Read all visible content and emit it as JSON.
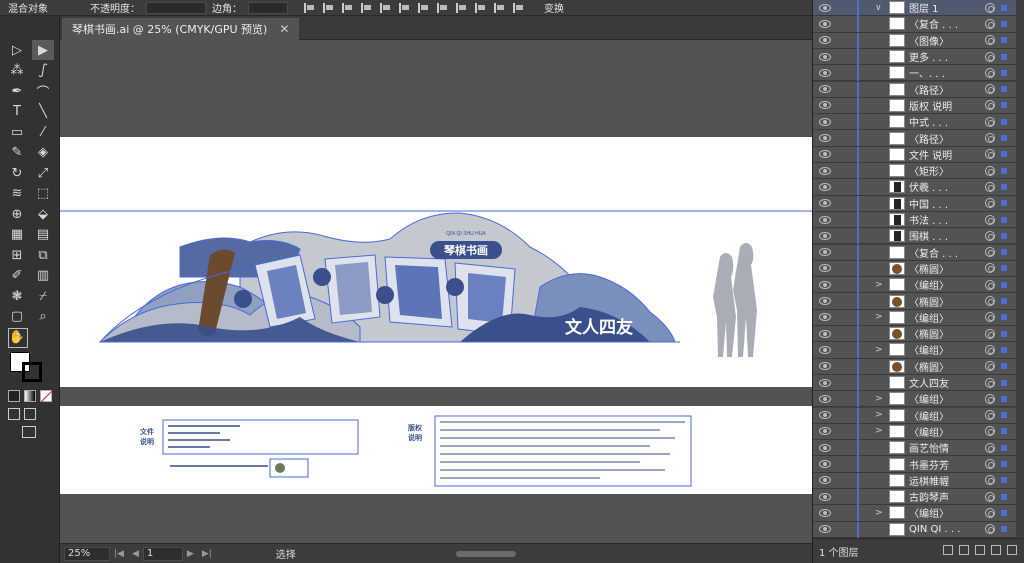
{
  "controlbar": {
    "blend_label": "混合对象",
    "opacity_label": "不透明度：",
    "corner_label": "边角：",
    "transform_label": "变换"
  },
  "document": {
    "tab_title": "琴棋书画.ai @ 25% (CMYK/GPU 预览)",
    "close_glyph": "✕"
  },
  "toolbar": {
    "help_label": "?",
    "left_tools": [
      "selection-tool",
      "magic-wand-tool",
      "pen-tool",
      "type-tool",
      "rectangle-tool",
      "pencil-tool",
      "rotate-tool",
      "warp-tool",
      "shape-builder-tool",
      "perspective-tool",
      "mesh-tool",
      "eyedropper-tool",
      "symbol-sprayer-tool",
      "artboard-tool",
      "hand-tool"
    ],
    "right_tools": [
      "direct-selection-tool",
      "lasso-tool",
      "curvature-tool",
      "line-tool",
      "paintbrush-tool",
      "eraser-tool",
      "scale-tool",
      "free-transform-tool",
      "live-paint-tool",
      "gradient-tool",
      "blend-tool",
      "column-graph-tool",
      "slice-tool",
      "zoom-tool"
    ],
    "left_glyphs": [
      "▷",
      "⁂",
      "✒",
      "T",
      "▭",
      "✎",
      "↻",
      "≋",
      "⊕",
      "▦",
      "⊞",
      "✐",
      "❃",
      "▢",
      "✋"
    ],
    "right_glyphs": [
      "▶",
      "ഽ",
      "⌒",
      "╲",
      "⁄",
      "◈",
      "⤢",
      "⬚",
      "⬙",
      "▤",
      "⧉",
      "▥",
      "⌿",
      "⌕"
    ]
  },
  "artwork": {
    "banner_title": "琴棋书画",
    "banner_subtitle": "QIN QI SHU HUA",
    "slogan": "文人四友",
    "colors": {
      "navy": "#3a4f8c",
      "lightgray": "#b9bec8",
      "brown": "#6b4a2e",
      "selection": "#4a6ad8"
    }
  },
  "notes": {
    "left_heading_1": "文件",
    "left_heading_2": "说明",
    "right_heading_1": "版权",
    "right_heading_2": "说明"
  },
  "statusbar": {
    "zoom": "25%",
    "page": "1",
    "status": "选择"
  },
  "layers": {
    "top_layer": "图层 1",
    "items": [
      {
        "name": "〈复合 . . .",
        "thumb": "white",
        "expand": ""
      },
      {
        "name": "〈图像〉",
        "thumb": "white",
        "expand": ""
      },
      {
        "name": "更多 . . .",
        "thumb": "white",
        "expand": ""
      },
      {
        "name": "一、. . .",
        "thumb": "white",
        "expand": ""
      },
      {
        "name": "〈路径〉",
        "thumb": "white",
        "expand": ""
      },
      {
        "name": "版权 说明",
        "thumb": "white",
        "expand": ""
      },
      {
        "name": "中式 . . .",
        "thumb": "white",
        "expand": ""
      },
      {
        "name": "〈路径〉",
        "thumb": "white",
        "expand": ""
      },
      {
        "name": "文件 说明",
        "thumb": "white",
        "expand": ""
      },
      {
        "name": "〈矩形〉",
        "thumb": "white",
        "expand": ""
      },
      {
        "name": "伏羲 . . .",
        "thumb": "dark",
        "expand": ""
      },
      {
        "name": "中国 . . .",
        "thumb": "dark",
        "expand": ""
      },
      {
        "name": "书法 . . .",
        "thumb": "dark",
        "expand": ""
      },
      {
        "name": "围棋 . . .",
        "thumb": "dark",
        "expand": ""
      },
      {
        "name": "〈复合 . . .",
        "thumb": "white",
        "expand": ""
      },
      {
        "name": "〈椭圆〉",
        "thumb": "circle",
        "expand": ""
      },
      {
        "name": "〈编组〉",
        "thumb": "white",
        "expand": ">"
      },
      {
        "name": "〈椭圆〉",
        "thumb": "circle",
        "expand": ""
      },
      {
        "name": "〈编组〉",
        "thumb": "white",
        "expand": ">"
      },
      {
        "name": "〈椭圆〉",
        "thumb": "circle",
        "expand": ""
      },
      {
        "name": "〈编组〉",
        "thumb": "white",
        "expand": ">"
      },
      {
        "name": "〈椭圆〉",
        "thumb": "circle",
        "expand": ""
      },
      {
        "name": "文人四友",
        "thumb": "white",
        "expand": ""
      },
      {
        "name": "〈编组〉",
        "thumb": "white",
        "expand": ">"
      },
      {
        "name": "〈编组〉",
        "thumb": "white",
        "expand": ">"
      },
      {
        "name": "〈编组〉",
        "thumb": "white",
        "expand": ">"
      },
      {
        "name": "画艺怡情",
        "thumb": "white",
        "expand": ""
      },
      {
        "name": "书墨芬芳",
        "thumb": "white",
        "expand": ""
      },
      {
        "name": "运棋帷幄",
        "thumb": "white",
        "expand": ""
      },
      {
        "name": "古韵琴声",
        "thumb": "white",
        "expand": ""
      },
      {
        "name": "〈编组〉",
        "thumb": "white",
        "expand": ">"
      },
      {
        "name": "QIN QI . . .",
        "thumb": "white",
        "expand": ""
      }
    ],
    "footer_count": "1 个图层"
  }
}
